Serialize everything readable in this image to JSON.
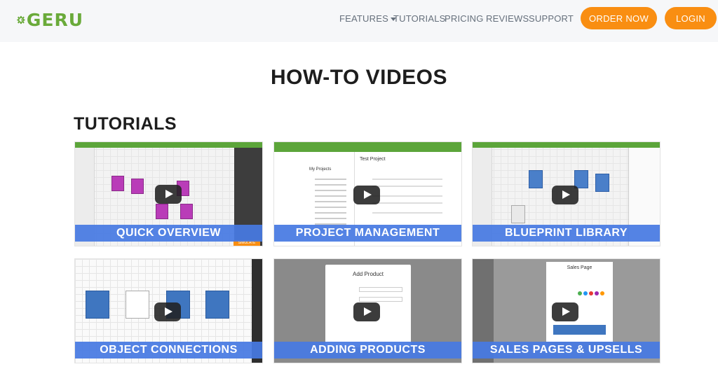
{
  "brand": {
    "logo_text": "GERU",
    "accent": "#6aaa3a",
    "button_color": "#f98e12",
    "caption_color": "#477ae2"
  },
  "nav": {
    "features": "FEATURES",
    "tutorials": "TUTORIALS",
    "pricing": "PRICING",
    "reviews": "REVIEWS",
    "support": "SUPPORT"
  },
  "buttons": {
    "order_now": "ORDER NOW",
    "login": "LOGIN"
  },
  "page": {
    "title": "HOW-TO VIDEOS",
    "section": "TUTORIALS"
  },
  "videos": [
    {
      "caption": "QUICK OVERVIEW"
    },
    {
      "caption": "PROJECT MANAGEMENT"
    },
    {
      "caption": "BLUEPRINT LIBRARY"
    },
    {
      "caption": "OBJECT CONNECTIONS"
    },
    {
      "caption": "ADDING PRODUCTS"
    },
    {
      "caption": "SALES PAGES & UPSELLS"
    }
  ],
  "thumb_text": {
    "test_project": "Test Project",
    "my_projects": "My Projects",
    "add_product": "Add Product",
    "sales_page": "Sales Page",
    "simulate": "SIMULATE"
  }
}
